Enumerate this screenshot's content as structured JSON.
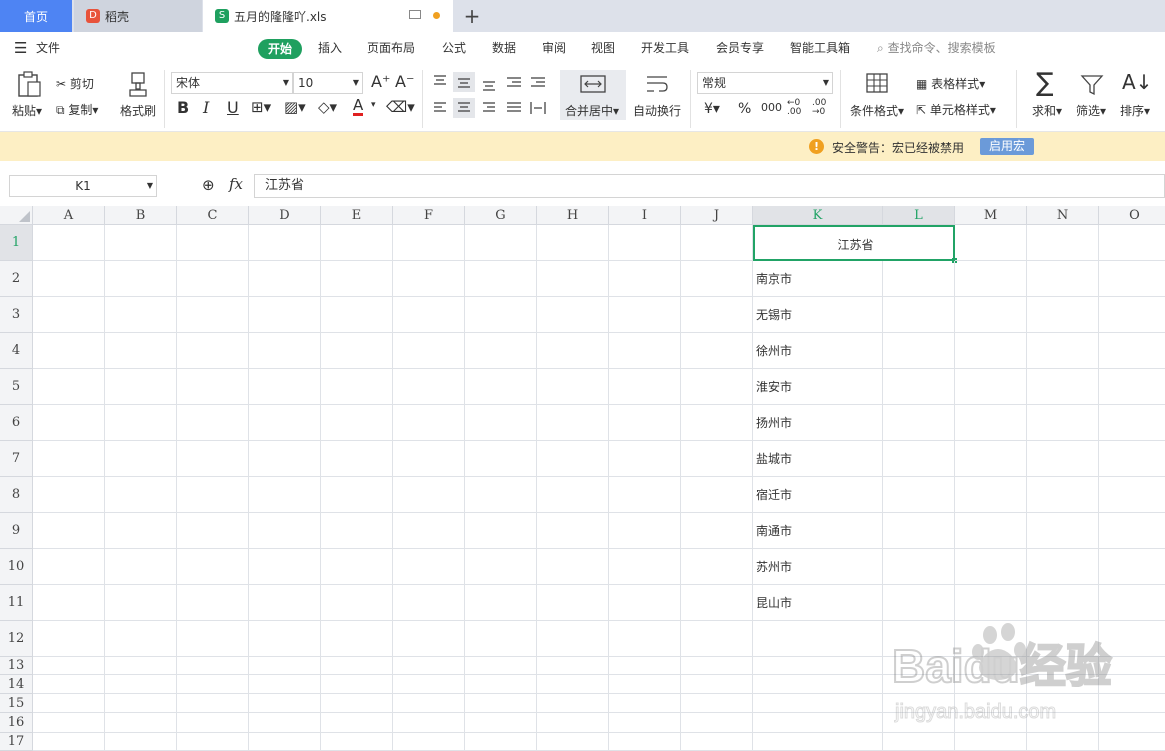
{
  "tabs": {
    "home": "首页",
    "daoke": "稻壳",
    "file": "五月的隆隆吖.xls",
    "plus": "+"
  },
  "menu": {
    "file": "文件",
    "items": [
      "开始",
      "插入",
      "页面布局",
      "公式",
      "数据",
      "审阅",
      "视图",
      "开发工具",
      "会员专享",
      "智能工具箱"
    ],
    "search": "查找命令、搜索模板"
  },
  "ribbon": {
    "paste": "粘贴",
    "cut": "剪切",
    "copy": "复制",
    "format_painter": "格式刷",
    "font_name": "宋体",
    "font_size": "10",
    "merge_center": "合并居中",
    "wrap_text": "自动换行",
    "number_format": "常规",
    "conditional_format": "条件格式",
    "table_style": "表格样式",
    "cell_style": "单元格样式",
    "sum": "求和",
    "filter": "筛选",
    "sort": "排序",
    "currency": "¥",
    "percent": "%",
    "thousands": "000"
  },
  "warning": {
    "text": "安全警告：宏已经被禁用",
    "button": "启用宏"
  },
  "formula": {
    "name_box": "K1",
    "fx": "fx",
    "value": "江苏省"
  },
  "grid": {
    "columns": [
      "A",
      "B",
      "C",
      "D",
      "E",
      "F",
      "G",
      "H",
      "I",
      "J",
      "K",
      "L",
      "M",
      "N",
      "O"
    ],
    "rows": [
      "1",
      "2",
      "3",
      "4",
      "5",
      "6",
      "7",
      "8",
      "9",
      "10",
      "11",
      "12",
      "13",
      "14",
      "15",
      "16",
      "17"
    ],
    "merged_K1": "江苏省",
    "k_values": [
      "南京市",
      "无锡市",
      "徐州市",
      "淮安市",
      "扬州市",
      "盐城市",
      "宿迁市",
      "南通市",
      "苏州市",
      "昆山市"
    ]
  },
  "watermark": {
    "brand": "Baidu经验",
    "url": "jingyan.baidu.com"
  },
  "colors": {
    "accent_green": "#1fa05f",
    "tab_blue": "#4e84f3",
    "warning_bg": "#fdefc4",
    "selection": "#21a366"
  }
}
